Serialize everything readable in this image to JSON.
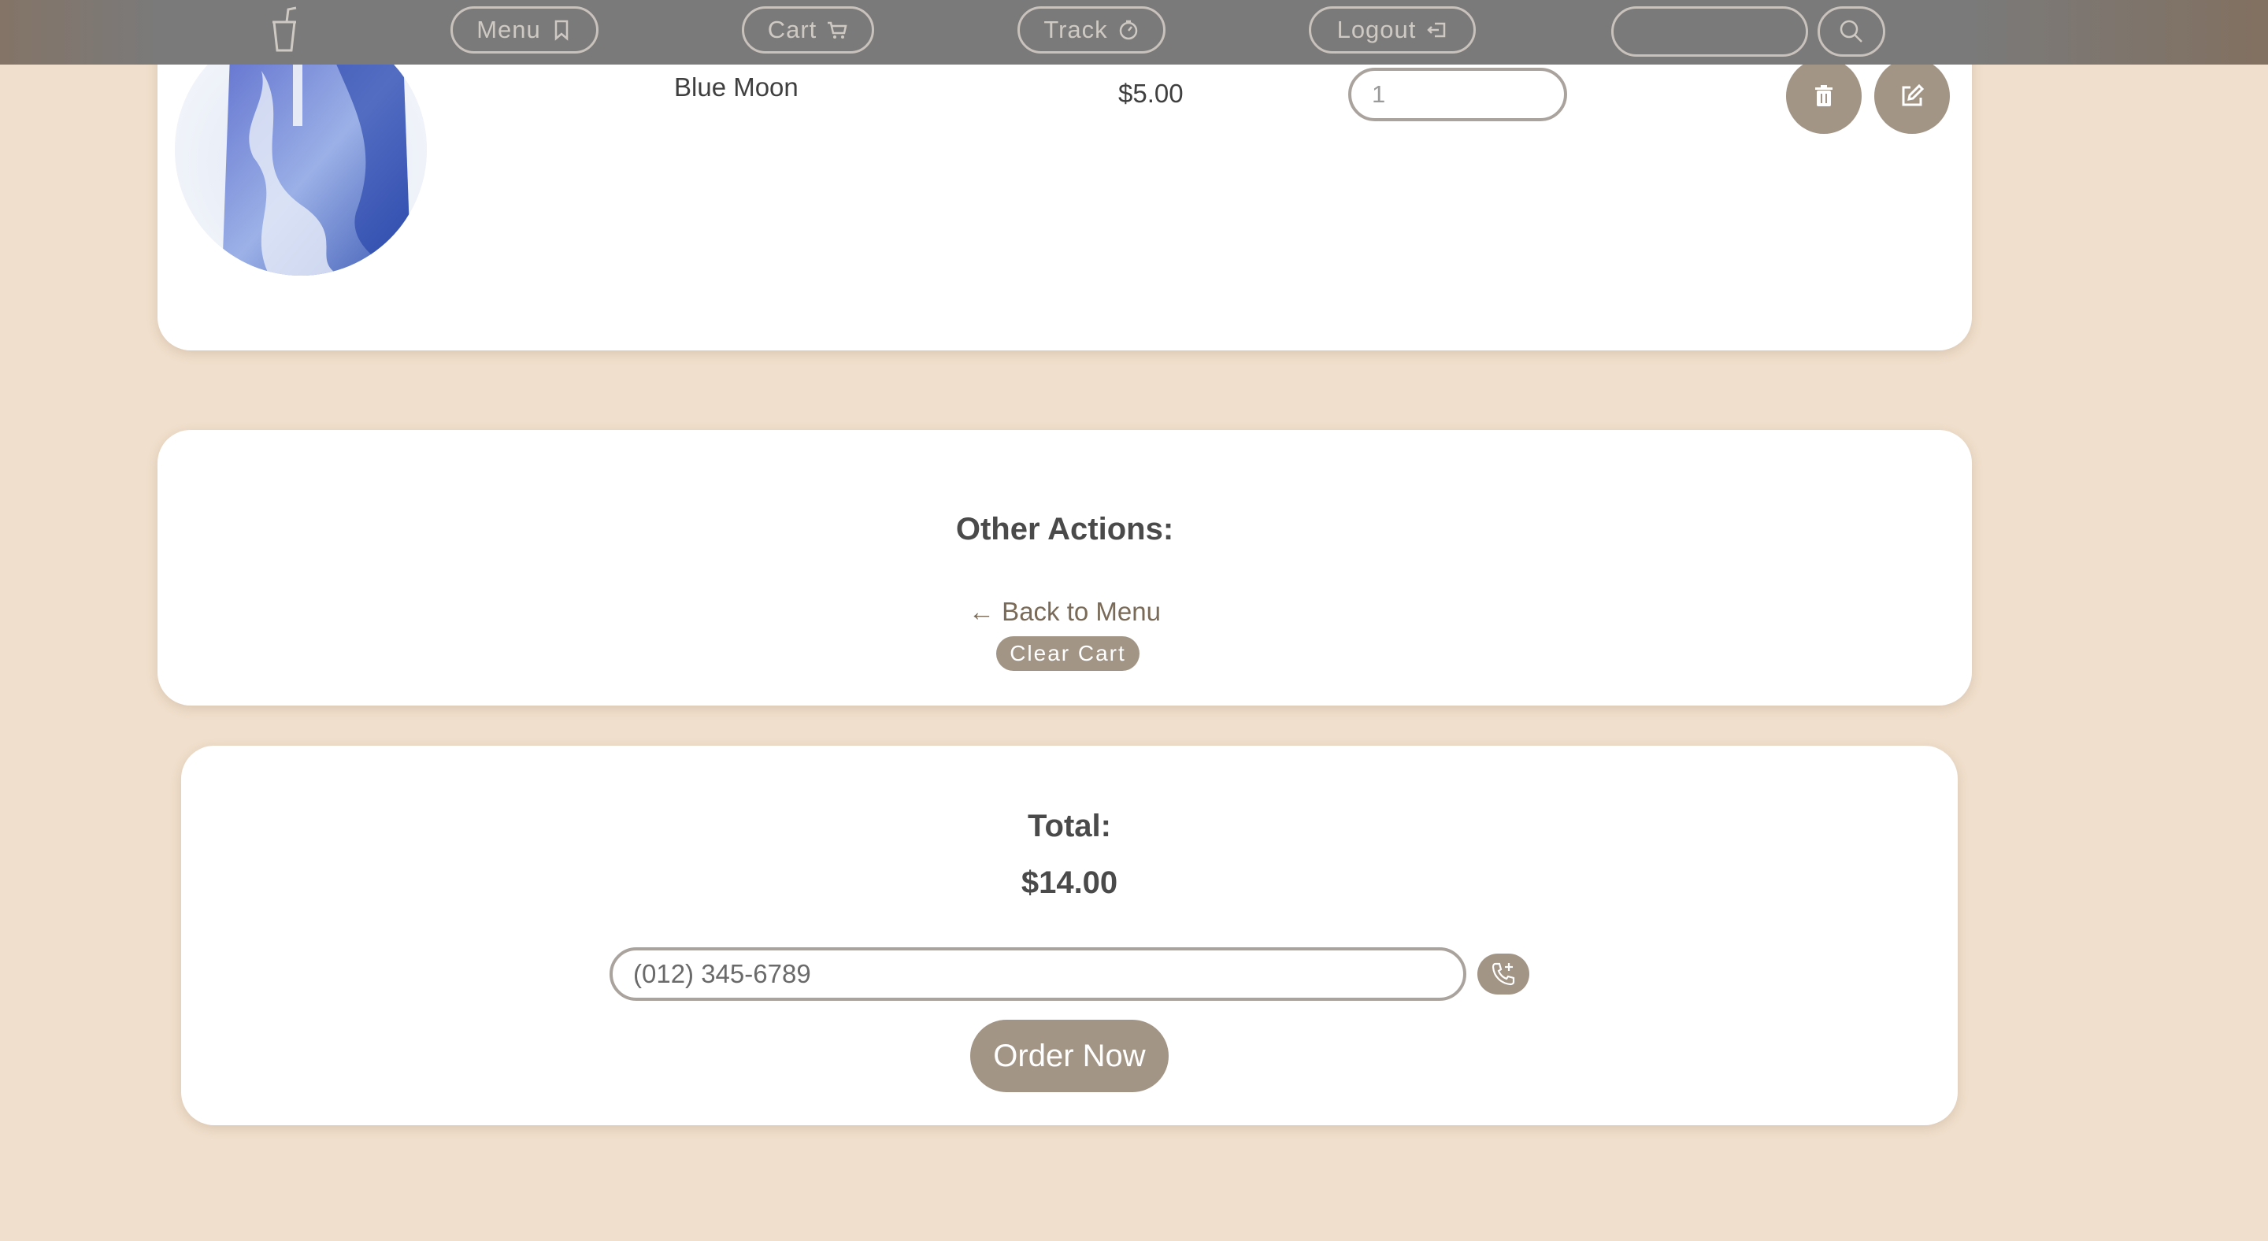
{
  "nav": {
    "menu": "Menu",
    "cart": "Cart",
    "track": "Track",
    "logout": "Logout",
    "search_value": ""
  },
  "cart_item": {
    "name": "Blue Moon",
    "price": "$5.00",
    "quantity": "1"
  },
  "other_actions": {
    "title": "Other Actions:",
    "back_link": "← Back to Menu",
    "clear_cart": "Clear Cart"
  },
  "summary": {
    "total_label": "Total:",
    "total_value": "$14.00",
    "phone_value": "(012) 345-6789",
    "order_button": "Order Now"
  },
  "colors": {
    "background": "#f0dfcc",
    "navbar": "#7a7a7a",
    "accent": "#a39585",
    "card": "#ffffff"
  },
  "icons": [
    "cup-logo-icon",
    "bookmark-icon",
    "cart-icon",
    "timer-icon",
    "logout-icon",
    "search-icon",
    "trash-icon",
    "edit-icon",
    "phone-plus-icon"
  ]
}
